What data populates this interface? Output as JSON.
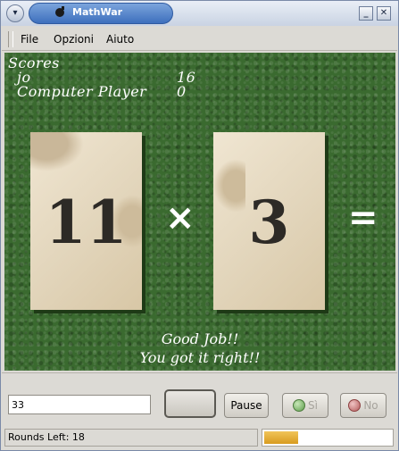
{
  "window": {
    "title": "MathWar"
  },
  "menubar": {
    "items": [
      "File",
      "Opzioni",
      "Aiuto"
    ]
  },
  "scores": {
    "heading": "Scores",
    "players": [
      {
        "name": "jo",
        "score": "16"
      },
      {
        "name": "Computer Player",
        "score": "0"
      }
    ]
  },
  "game": {
    "left_card": "11",
    "operator": "×",
    "right_card": "3",
    "equals": "=",
    "feedback_line1": "Good Job!!",
    "feedback_line2": "You got it right!!"
  },
  "controls": {
    "answer_value": "33",
    "pause_label": "Pause",
    "yes_label": "Sì",
    "no_label": "No"
  },
  "status": {
    "rounds_left_text": "Rounds Left: 18",
    "progress_fraction": 0.27
  },
  "colors": {
    "felt_green": "#3a6a2f",
    "title_blue": "#3d6fbd",
    "progress_amber": "#d89b1e"
  },
  "icons": {
    "window_menu": "chevron-down-icon",
    "app": "bomb-icon",
    "minimize": "minimize-icon",
    "close": "close-icon",
    "yes_led": "green-led-icon",
    "no_led": "red-led-icon"
  }
}
